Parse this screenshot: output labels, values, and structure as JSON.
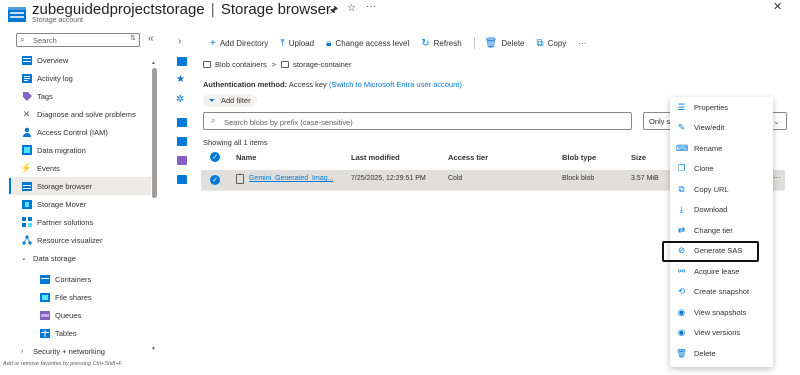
{
  "header": {
    "title": "zubeguidedprojectstorage",
    "separator": "|",
    "page": "Storage browser",
    "subtitle": "Storage account",
    "pin_icon": "pin-icon",
    "star_icon": "star-icon",
    "more_icon": "more-icon",
    "close_icon": "close-icon"
  },
  "sidebar": {
    "search_placeholder": "Search",
    "items": [
      {
        "label": "Overview",
        "icon": "overview-icon"
      },
      {
        "label": "Activity log",
        "icon": "activity-log-icon"
      },
      {
        "label": "Tags",
        "icon": "tag-icon"
      },
      {
        "label": "Diagnose and solve problems",
        "icon": "wrench-icon"
      },
      {
        "label": "Access Control (IAM)",
        "icon": "people-icon"
      },
      {
        "label": "Data migration",
        "icon": "data-migration-icon"
      },
      {
        "label": "Events",
        "icon": "lightning-icon"
      },
      {
        "label": "Storage browser",
        "icon": "storage-browser-icon"
      },
      {
        "label": "Storage Mover",
        "icon": "storage-mover-icon"
      },
      {
        "label": "Partner solutions",
        "icon": "partner-icon"
      },
      {
        "label": "Resource visualizer",
        "icon": "visualizer-icon"
      },
      {
        "label": "Data storage",
        "icon": "chevron-down-icon"
      },
      {
        "label": "Containers",
        "icon": "containers-icon"
      },
      {
        "label": "File shares",
        "icon": "file-shares-icon"
      },
      {
        "label": "Queues",
        "icon": "queues-icon"
      },
      {
        "label": "Tables",
        "icon": "tables-icon"
      },
      {
        "label": "Security + networking",
        "icon": "chevron-right-icon"
      }
    ],
    "footnote": "Add or remove favorites by pressing Ctrl+Shift+F"
  },
  "toolbar": {
    "add_directory": "Add Directory",
    "upload": "Upload",
    "change_access_level": "Change access level",
    "refresh": "Refresh",
    "delete": "Delete",
    "copy": "Copy",
    "more": "···"
  },
  "breadcrumb": {
    "root": "Blob containers",
    "sep": ">",
    "container": "storage-container"
  },
  "auth": {
    "label": "Authentication method:",
    "value": "Access key",
    "link": "(Switch to Microsoft Entra user account)"
  },
  "filter": {
    "add_filter": "Add filter",
    "search_placeholder": "Search blobs by prefix (case-sensitive)",
    "only_show": "Only sh"
  },
  "listing": {
    "showing": "Showing all 1 items",
    "columns": [
      "Name",
      "Last modified",
      "Access tier",
      "Blob type",
      "Size"
    ],
    "rows": [
      {
        "name": "Gemini_Generated_Imag...",
        "last_modified": "7/25/2025, 12:29:51 PM",
        "access_tier": "Cold",
        "blob_type": "Block blob",
        "size": "3.57 MiB"
      }
    ]
  },
  "context_menu": {
    "items": [
      {
        "label": "Properties",
        "icon": "properties-icon"
      },
      {
        "label": "View/edit",
        "icon": "edit-icon"
      },
      {
        "label": "Rename",
        "icon": "rename-icon"
      },
      {
        "label": "Clone",
        "icon": "clone-icon"
      },
      {
        "label": "Copy URL",
        "icon": "copy-icon"
      },
      {
        "label": "Download",
        "icon": "download-icon"
      },
      {
        "label": "Change tier",
        "icon": "change-tier-icon"
      },
      {
        "label": "Generate SAS",
        "icon": "link-icon"
      },
      {
        "label": "Acquire lease",
        "icon": "lease-icon"
      },
      {
        "label": "Create snapshot",
        "icon": "snapshot-icon"
      },
      {
        "label": "View snapshots",
        "icon": "view-icon"
      },
      {
        "label": "View versions",
        "icon": "view-icon"
      },
      {
        "label": "Delete",
        "icon": "trash-icon"
      }
    ],
    "highlighted": "Generate SAS"
  },
  "colors": {
    "accent": "#0078d4",
    "selected_row": "#e1dfdd",
    "nav_selected": "#edebe9"
  }
}
